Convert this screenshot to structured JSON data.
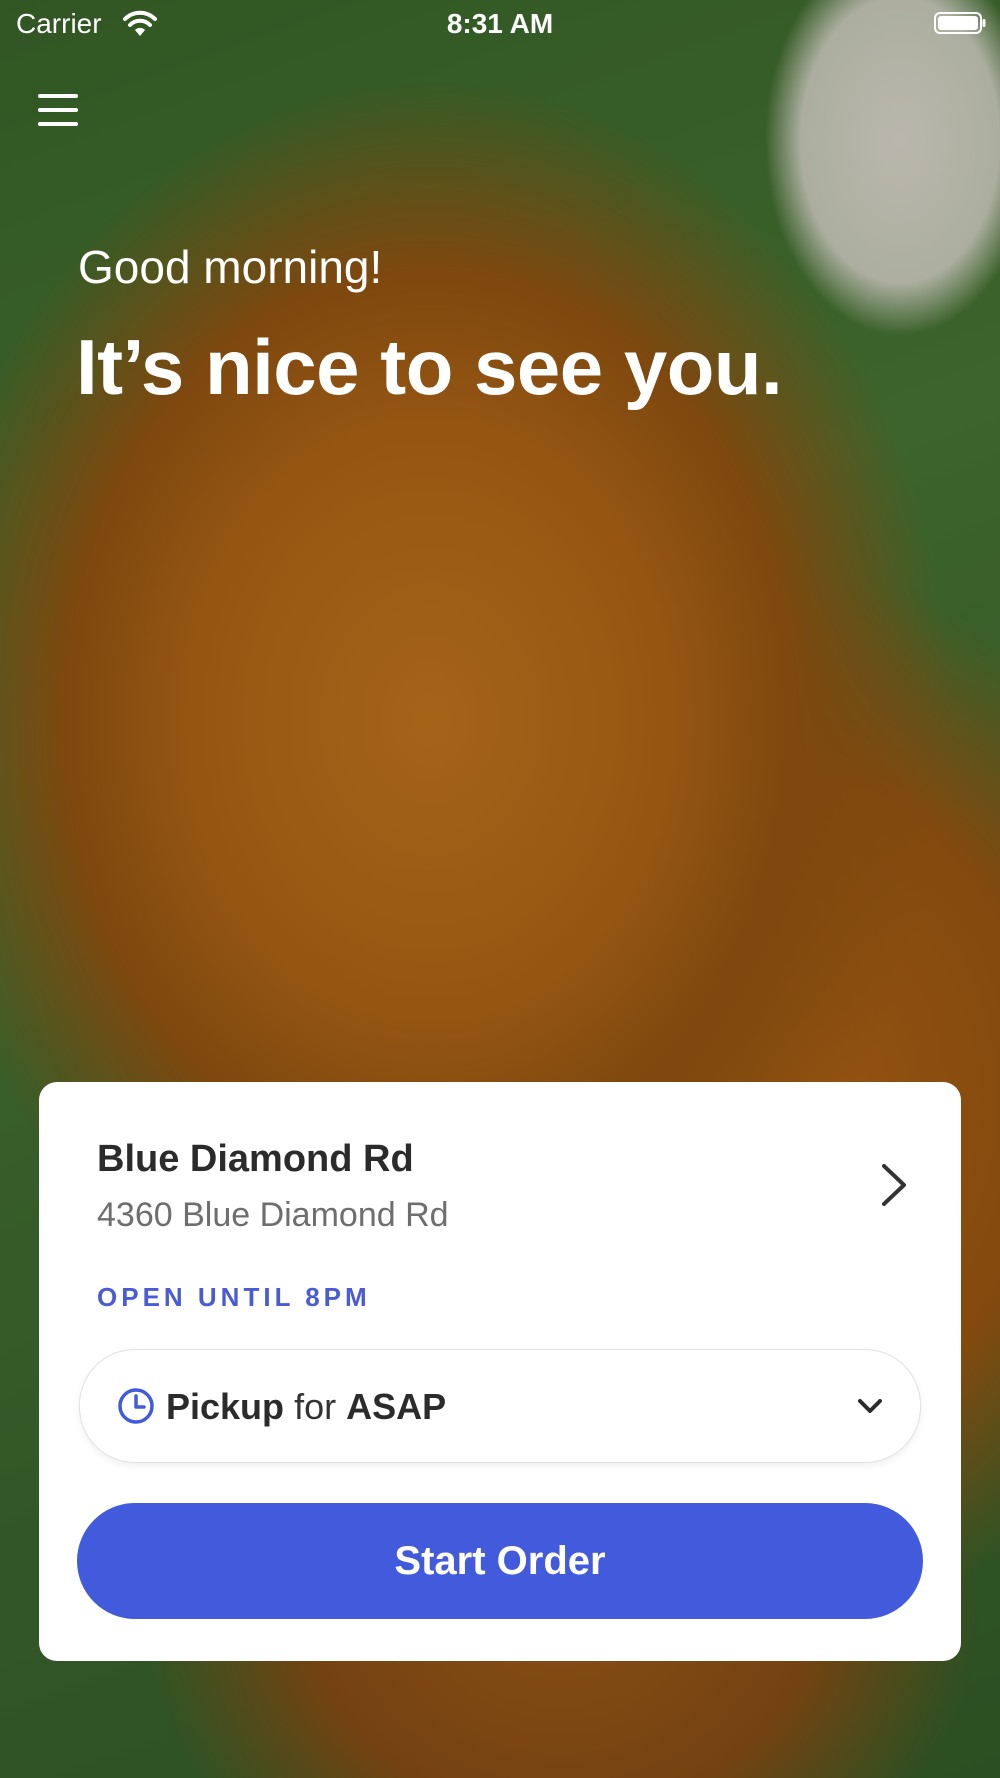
{
  "status_bar": {
    "carrier": "Carrier",
    "time": "8:31 AM"
  },
  "hero": {
    "greeting": "Good morning!",
    "headline": "It’s nice to see you."
  },
  "location_card": {
    "name": "Blue Diamond Rd",
    "address": "4360 Blue Diamond Rd",
    "open_status": "OPEN UNTIL 8PM",
    "pickup": {
      "mode": "Pickup",
      "connector": "for",
      "time": "ASAP"
    },
    "start_button": "Start Order"
  },
  "colors": {
    "accent": "#425bdc",
    "open_status": "#4a5bd6"
  },
  "icons": [
    "wifi-icon",
    "battery-icon",
    "menu-icon",
    "chevron-right-icon",
    "clock-icon",
    "chevron-down-icon"
  ]
}
